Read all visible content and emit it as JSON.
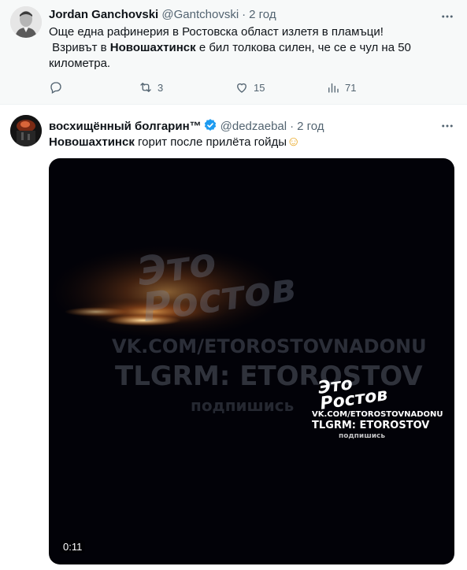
{
  "tweets": [
    {
      "display_name": "Jordan Ganchovski",
      "handle": "@Gantchovski",
      "time": "2 год",
      "text_line1": "Още една рафинерия в Ростовска  област излетя в пламъци!",
      "text_line2_before": "Взривът в ",
      "text_line2_bold": "Новошахтинск",
      "text_line2_after": " е бил толкова силен, че се е чул на 50",
      "text_line3": "километра.",
      "replies": "",
      "reposts": "3",
      "likes": "15",
      "views": "71"
    },
    {
      "display_name": "восхищённый болгарин™",
      "handle": "@dedzaebal",
      "time": "2 год",
      "text_bold": "Новошахтинск",
      "text_rest": " горит после прилёта гойды",
      "emoji": "☺",
      "video_duration": "0:11",
      "watermark_large": {
        "brand_line1": "Этo",
        "brand_line2": "Ростов",
        "url": "VK.COM/ETOROSTOVNADONU",
        "tg": "TLGRM: ETOROSTOV",
        "sub": "подпишись"
      },
      "watermark_small": {
        "brand_line1": "Этo",
        "brand_line2": "Ростов",
        "url": "VK.COM/ETOROSTOVNADONU",
        "tg": "TLGRM: ETOROSTOV",
        "sub": "подпишись"
      }
    }
  ],
  "colors": {
    "text_primary": "#0f1419",
    "text_secondary": "#536471",
    "verified_blue": "#1d9bf0",
    "tweet1_bg": "#f7f9f9"
  },
  "icons": {
    "more": "more-icon",
    "reply": "reply-icon",
    "repost": "repost-icon",
    "like": "like-icon",
    "views": "views-icon",
    "verified": "verified-badge-icon"
  }
}
